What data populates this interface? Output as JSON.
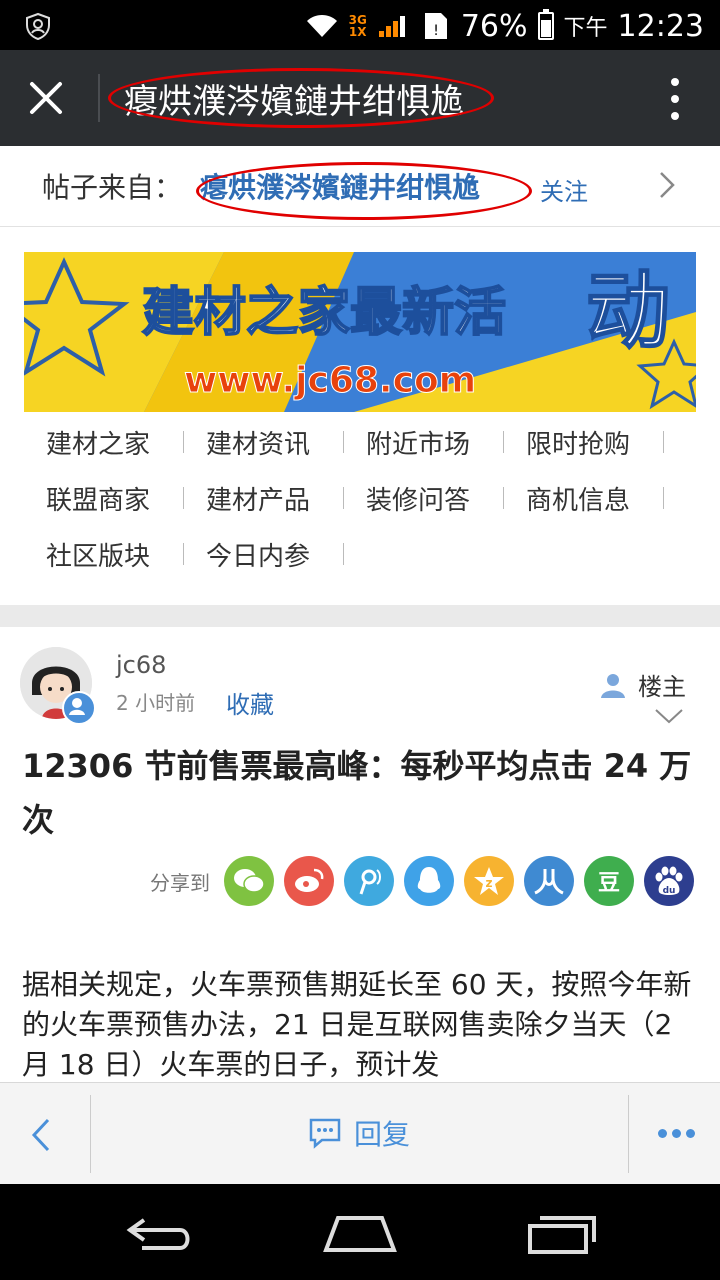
{
  "status_bar": {
    "network": "3G",
    "network_sub": "1X",
    "battery_percent": "76%",
    "ampm": "下午",
    "time": "12:23"
  },
  "title_bar": {
    "title": "瘪烘濮涔嬪鏈井绀惧尯"
  },
  "source": {
    "label": "帖子来自：",
    "name": "瘪烘濮涔嬪鏈井绀惧尯",
    "follow": "关注"
  },
  "banner": {
    "headline": "建材之家最新活",
    "headline_big": "动",
    "url": "www.jc68.com"
  },
  "links": [
    [
      "建材之家",
      "建材资讯",
      "附近市场",
      "限时抢购"
    ],
    [
      "联盟商家",
      "建材产品",
      "装修问答",
      "商机信息"
    ],
    [
      "社区版块",
      "今日内参"
    ]
  ],
  "post": {
    "author": "jc68",
    "time": "2 小时前",
    "favorite": "收藏",
    "owner": "楼主",
    "title": "12306 节前售票最高峰：每秒平均点击 24 万次",
    "share_label": "分享到",
    "share_icons": [
      {
        "name": "wechat-icon",
        "color": "#7fc241"
      },
      {
        "name": "weibo-icon",
        "color": "#e9574b"
      },
      {
        "name": "tencent-weibo-icon",
        "color": "#3fa9df"
      },
      {
        "name": "qq-icon",
        "color": "#3fa2e8"
      },
      {
        "name": "qzone-icon",
        "color": "#f7b330"
      },
      {
        "name": "renren-icon",
        "color": "#3f8ad2"
      },
      {
        "name": "douban-icon",
        "color": "#3fae4e",
        "text": "豆"
      },
      {
        "name": "baidu-icon",
        "color": "#2d3e8f"
      }
    ],
    "body": "据相关规定，火车票预售期延长至 60 天，按照今年新的火车票预售办法，21 日是互联网售卖除夕当天（2 月 18 日）火车票的日子，预计发"
  },
  "bottom_bar": {
    "reply": "回复"
  },
  "colors": {
    "accent": "#2f6db5",
    "reply_blue": "#4a90d9",
    "title_bar_bg": "#2b2e31",
    "red_annotation": "#e00000"
  }
}
